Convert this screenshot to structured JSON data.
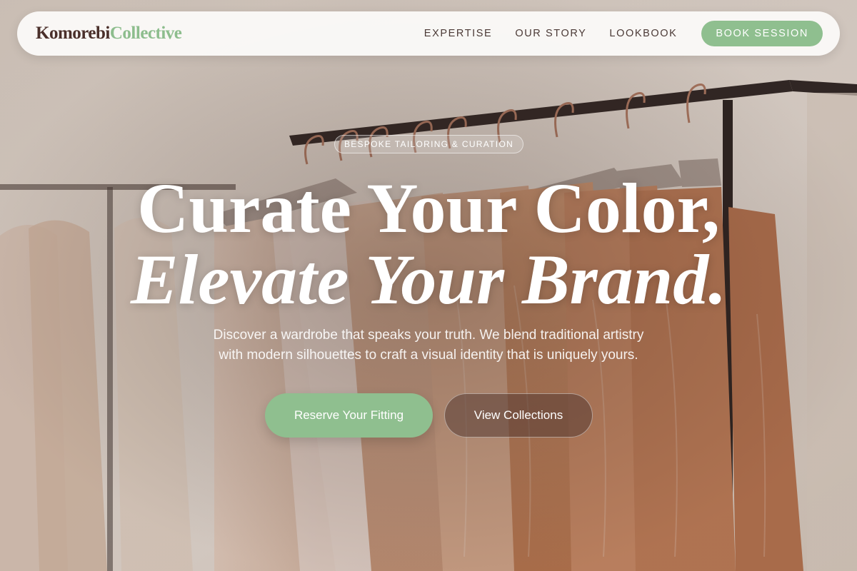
{
  "brand": {
    "logo_part_1": "Komorebi",
    "logo_part_2": "Collective",
    "accent_color": "#8fbf8f"
  },
  "nav": {
    "links": [
      "EXPERTISE",
      "OUR STORY",
      "LOOKBOOK"
    ],
    "cta_label": "BOOK SESSION"
  },
  "hero": {
    "eyebrow": "BESPOKE TAILORING & CURATION",
    "headline_line_1": "Curate Your Color,",
    "headline_line_2": "Elevate Your Brand.",
    "lede_line_1": "Discover a wardrobe that speaks your truth. We blend traditional artistry",
    "lede_line_2": "with modern silhouettes to craft a visual identity that is uniquely yours.",
    "primary_cta": "Reserve Your Fitting",
    "secondary_cta": "View Collections"
  }
}
